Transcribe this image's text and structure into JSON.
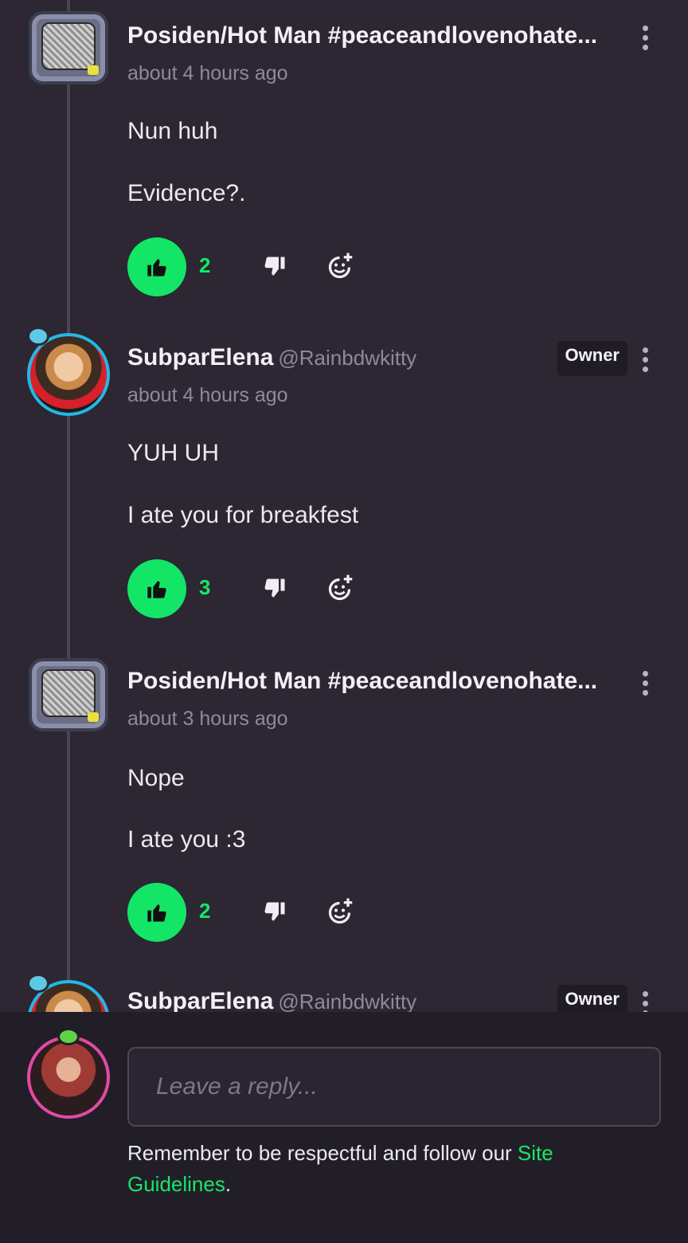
{
  "colors": {
    "background": "#2c2733",
    "accent": "#13e667",
    "composer_bg": "#221e28"
  },
  "comments": [
    {
      "name": "Posiden/Hot Man #peaceandlovenohate...",
      "handle": "",
      "owner": "",
      "time": "about 4 hours ago",
      "lines": [
        "Nun huh",
        "Evidence?."
      ],
      "likes": "2",
      "avatar_icon": "tv-avatar"
    },
    {
      "name": "SubparElena",
      "handle": "@Rainbdwkitty",
      "owner": "Owner",
      "time": "about 4 hours ago",
      "lines": [
        "YUH UH",
        "I ate you for breakfest"
      ],
      "likes": "3",
      "avatar_icon": "user-photo-avatar"
    },
    {
      "name": "Posiden/Hot Man #peaceandlovenohate...",
      "handle": "",
      "owner": "",
      "time": "about 3 hours ago",
      "lines": [
        "Nope",
        "I ate you  :3"
      ],
      "likes": "2",
      "avatar_icon": "tv-avatar"
    },
    {
      "name": "SubparElena",
      "handle": "@Rainbdwkitty",
      "owner": "Owner",
      "avatar_icon": "user-photo-avatar"
    }
  ],
  "icons": {
    "like": "thumbs-up-icon",
    "dislike": "thumbs-down-icon",
    "react": "add-reaction-icon",
    "more": "more-vertical-icon"
  },
  "composer": {
    "placeholder": "Leave a reply...",
    "notice_prefix": "Remember to be respectful and follow our ",
    "notice_link": "Site Guidelines",
    "notice_suffix": "."
  }
}
